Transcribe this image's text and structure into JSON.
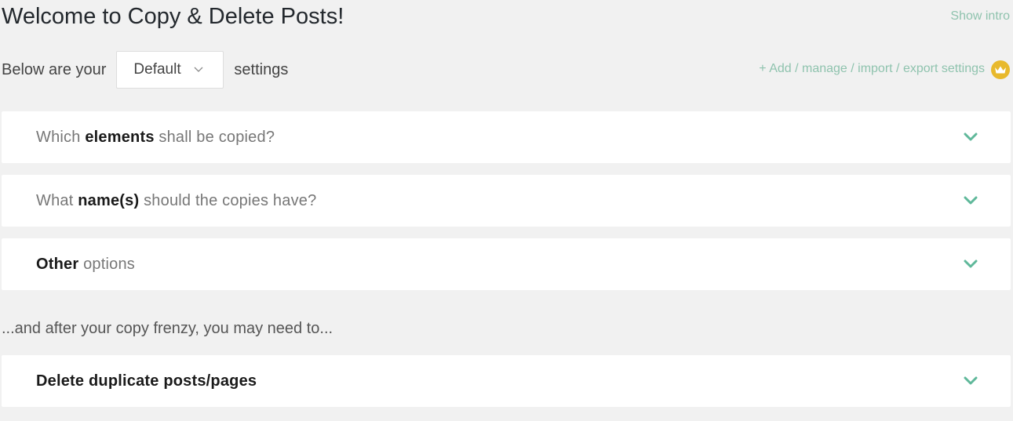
{
  "header": {
    "title": "Welcome to Copy & Delete Posts!",
    "show_intro": "Show intro"
  },
  "settings": {
    "prefix": "Below are your",
    "selected": "Default",
    "suffix": "settings",
    "manage_link": "+ Add / manage / import / export settings"
  },
  "panels": [
    {
      "pre": "Which ",
      "strong": "elements",
      "post": " shall be copied?"
    },
    {
      "pre": "What ",
      "strong": "name(s)",
      "post": " should the copies have?"
    },
    {
      "pre": "",
      "strong": "Other",
      "post": " options"
    }
  ],
  "after_text": "...and after your copy frenzy, you may need to...",
  "delete_panel": {
    "label": "Delete duplicate posts/pages"
  },
  "icons": {
    "chevron": "chevron-down-icon",
    "crown": "crown-icon",
    "select_caret": "chevron-down-icon"
  },
  "colors": {
    "accent": "#5fb89a",
    "link": "#8fc3ae",
    "crown": "#e8b92c",
    "background": "#f1f1f1"
  }
}
